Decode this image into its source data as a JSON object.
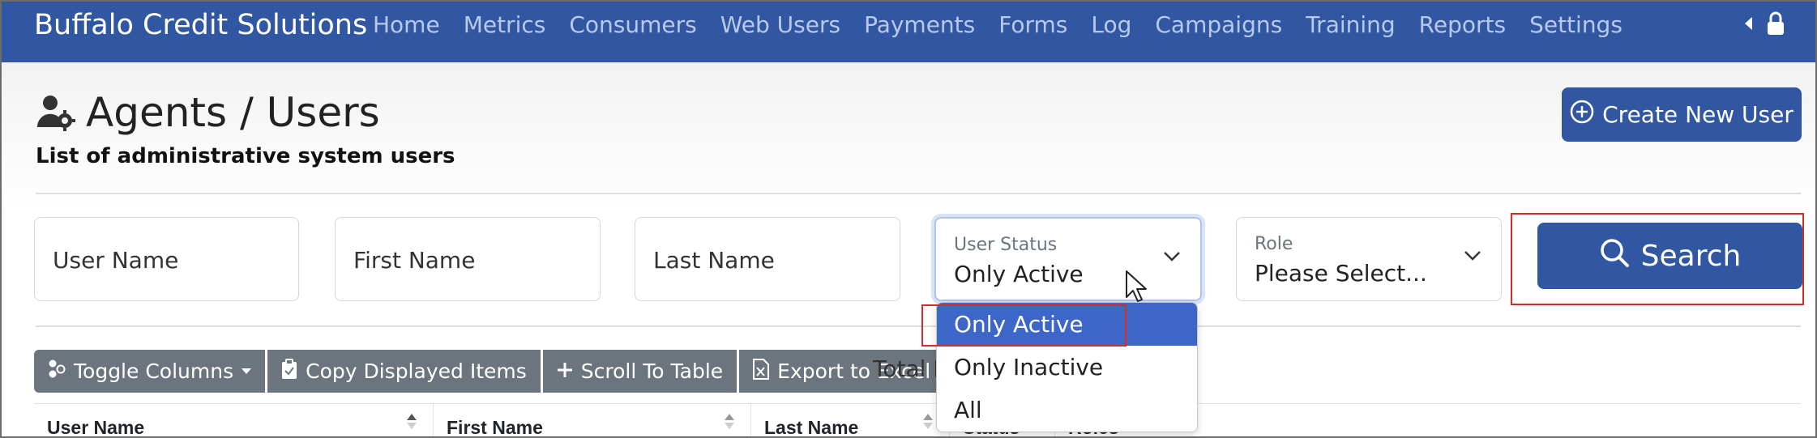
{
  "navbar": {
    "brand": "Buffalo Credit Solutions",
    "items": [
      "Home",
      "Metrics",
      "Consumers",
      "Web Users",
      "Payments",
      "Forms",
      "Log",
      "Campaigns",
      "Training",
      "Reports",
      "Settings"
    ]
  },
  "header": {
    "title": "Agents / Users",
    "subtitle": "List of administrative system users",
    "create_button": "Create New User"
  },
  "filters": {
    "user_name_placeholder": "User Name",
    "first_name_placeholder": "First Name",
    "last_name_placeholder": "Last Name",
    "user_status": {
      "label": "User Status",
      "value": "Only Active",
      "options": [
        "Only Active",
        "Only Inactive",
        "All"
      ]
    },
    "role": {
      "label": "Role",
      "value": "Please Select..."
    },
    "search_button": "Search"
  },
  "toolbar": {
    "toggle_columns": "Toggle Columns",
    "copy_items": "Copy Displayed Items",
    "scroll_to_table": "Scroll To Table",
    "export_excel": "Export to Excel",
    "total_label": "Total I"
  },
  "table": {
    "columns": [
      "User Name",
      "First Name",
      "Last Name",
      "Status",
      "Roles"
    ]
  },
  "colors": {
    "primary": "#3157a3",
    "secondary": "#6c757d",
    "highlight": "#d62b2b",
    "selected": "#3d66c9"
  }
}
